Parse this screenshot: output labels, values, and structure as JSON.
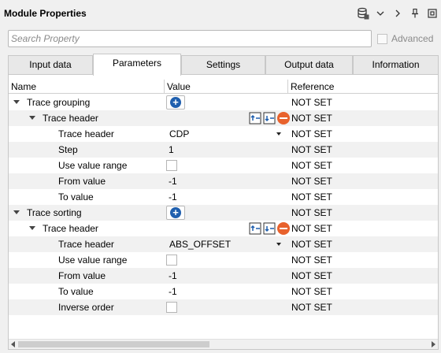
{
  "window": {
    "title": "Module Properties"
  },
  "toolbar_icons": [
    "database-icon",
    "chevron-down-icon",
    "chevron-right-icon",
    "pin-icon",
    "float-icon"
  ],
  "search": {
    "placeholder": "Search Property",
    "value": ""
  },
  "advanced": {
    "label": "Advanced",
    "checked": false
  },
  "tabs": [
    {
      "label": "Input data",
      "active": false
    },
    {
      "label": "Parameters",
      "active": true
    },
    {
      "label": "Settings",
      "active": false
    },
    {
      "label": "Output data",
      "active": false
    },
    {
      "label": "Information",
      "active": false
    }
  ],
  "columns": {
    "name": "Name",
    "value": "Value",
    "reference": "Reference"
  },
  "rows": [
    {
      "name": "Trace grouping",
      "value": "",
      "reference": "NOT SET"
    },
    {
      "name": "Trace header",
      "value": "",
      "reference": "NOT SET"
    },
    {
      "name": "Trace header",
      "value": "CDP",
      "reference": "NOT SET"
    },
    {
      "name": "Step",
      "value": "1",
      "reference": "NOT SET"
    },
    {
      "name": "Use value range",
      "value": "",
      "reference": "NOT SET"
    },
    {
      "name": "From value",
      "value": "-1",
      "reference": "NOT SET"
    },
    {
      "name": "To value",
      "value": "-1",
      "reference": "NOT SET"
    },
    {
      "name": "Trace sorting",
      "value": "",
      "reference": "NOT SET"
    },
    {
      "name": "Trace header",
      "value": "",
      "reference": "NOT SET"
    },
    {
      "name": "Trace header",
      "value": "ABS_OFFSET",
      "reference": "NOT SET"
    },
    {
      "name": "Use value range",
      "value": "",
      "reference": "NOT SET"
    },
    {
      "name": "From value",
      "value": "-1",
      "reference": "NOT SET"
    },
    {
      "name": "To value",
      "value": "-1",
      "reference": "NOT SET"
    },
    {
      "name": "Inverse order",
      "value": "",
      "reference": "NOT SET"
    }
  ],
  "colors": {
    "add_button": "#1f5fae",
    "remove_button": "#e8622d",
    "alt_row": "#f1f1f1"
  }
}
